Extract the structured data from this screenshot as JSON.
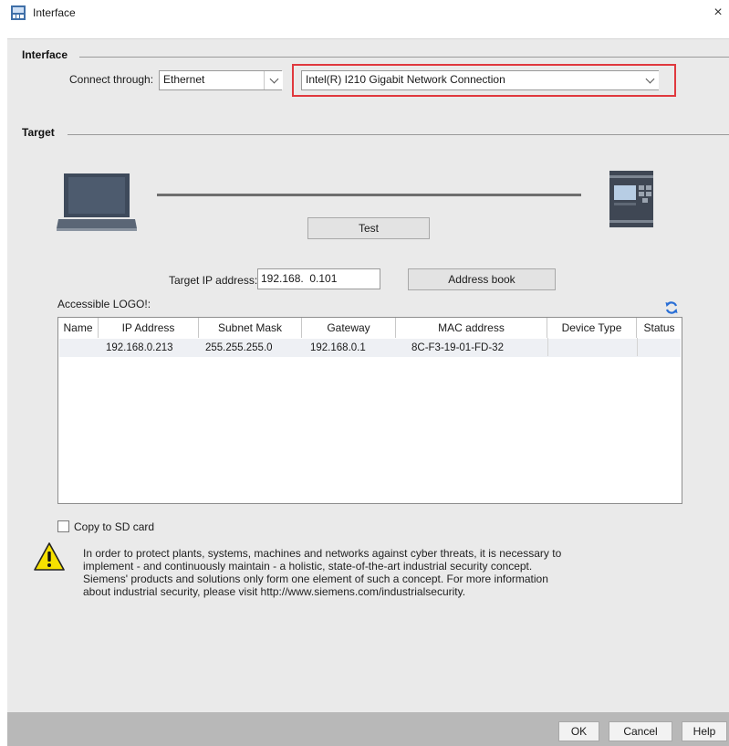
{
  "window": {
    "title": "Interface",
    "close_glyph": "×",
    "app_icon": "logo-app-icon"
  },
  "interface_section": {
    "title": "Interface",
    "connect_label": "Connect through:",
    "connect_value": "Ethernet",
    "adapter_value": "Intel(R) I210 Gigabit Network Connection",
    "highlight_color": "#e0393e"
  },
  "target_section": {
    "title": "Target",
    "test_button": "Test",
    "target_ip_label": "Target IP address:",
    "target_ip_value": "192.168.  0.101",
    "address_book_button": "Address book",
    "accessible_label": "Accessible LOGO!:",
    "refresh_icon": "refresh-icon",
    "refresh_color": "#2a6fd6"
  },
  "table": {
    "columns": [
      "Name",
      "IP Address",
      "Subnet Mask",
      "Gateway",
      "MAC address",
      "Device Type",
      "Status"
    ],
    "rows": [
      {
        "name": "",
        "ip": "192.168.0.213",
        "subnet": "255.255.255.0",
        "gateway": "192.168.0.1",
        "mac": "8C-F3-19-01-FD-32",
        "device_type": "",
        "status": ""
      }
    ]
  },
  "copy_to_sd": {
    "label": "Copy to SD card",
    "checked": false
  },
  "security_note": {
    "icon": "warning-icon",
    "text": "In order to protect plants, systems, machines and networks against cyber threats, it is necessary to implement - and continuously maintain - a holistic, state-of-the-art industrial security concept. Siemens' products and solutions only form one element of such a concept. For more information about industrial security, please visit http://www.siemens.com/industrialsecurity."
  },
  "footer": {
    "ok": "OK",
    "cancel": "Cancel",
    "help": "Help"
  }
}
